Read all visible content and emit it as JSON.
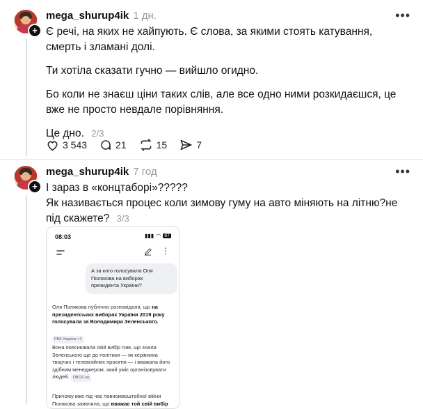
{
  "post1": {
    "username": "mega_shurup4ik",
    "time": "1 дн.",
    "paragraphs": [
      "Є речі, на яких не хайпують. Є слова, за якими стоять катування, смерть і зламані долі.",
      "Ти хотіла сказати гучно — вийшло огидно.",
      "Бо коли не знаєш ціни таких слів, але все одно ними розкидаєшся, це вже не просто невдале порівняння.",
      "Це дно."
    ],
    "counter": "2/3",
    "likes": "3 543",
    "comments": "21",
    "reposts": "15",
    "shares": "7"
  },
  "post2": {
    "username": "mega_shurup4ik",
    "time": "7 год",
    "line1": "І зараз в «концтаборі»?????",
    "line2": "Як називається процес коли зимову гуму на авто міняють на літню?не під скажете?",
    "counter": "3/3",
    "screenshot": {
      "status_time": "08:03",
      "battery": "87",
      "question": "А за кого голосувала Оля Полякова на виборах президента України?",
      "answer1_plain": "Оля Полякова публічно розповідала, що",
      "answer1_bold": "на президентських виборах України 2019 року голосувала за Володимира Зеленського.",
      "source1": "РБК-Україна +1",
      "answer2": "Вона пояснювала свій вибір тим, що знала Зеленського ще до політики — як керівника творчих і телевізійних проєктів — і вважала його здібним менеджером, який уміє організовувати людей.",
      "source2": "OBOZ.ua",
      "answer3_plain": "Причому вже під час повномасштабної війни Полякова заявляла, що",
      "answer3_bold": "вважає той свій вибір"
    }
  }
}
